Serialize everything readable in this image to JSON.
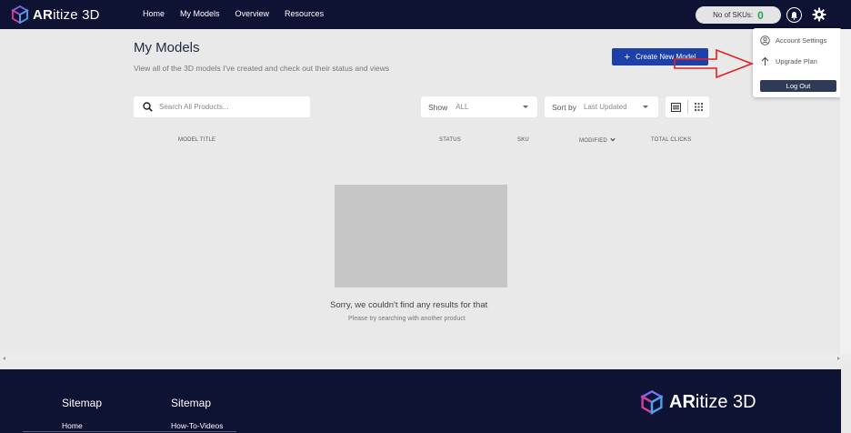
{
  "brand": {
    "name_bold": "AR",
    "name_rest": "itize 3D",
    "color": "#0e1233"
  },
  "nav": {
    "items": [
      "Home",
      "My Models",
      "Overview",
      "Resources"
    ]
  },
  "sku": {
    "label": "No of SKUs:",
    "count": "0"
  },
  "account_menu": {
    "items": [
      {
        "label": "Account Settings",
        "icon": "user-circle-icon"
      },
      {
        "label": "Upgrade Plan",
        "icon": "arrow-up-icon"
      }
    ],
    "logout_label": "Log Out"
  },
  "page": {
    "title": "My Models",
    "subtitle": "View all of the 3D models I've created and check out their status and views",
    "create_label": "Create New Model"
  },
  "search": {
    "placeholder": "Search All Products..."
  },
  "show": {
    "label": "Show",
    "value": "ALL"
  },
  "sort": {
    "label": "Sort by",
    "value": "Last Updated"
  },
  "table": {
    "columns": [
      "MODEL TITLE",
      "STATUS",
      "SKU",
      "MODIFIED",
      "TOTAL CLICKS"
    ]
  },
  "empty_state": {
    "title": "Sorry, we couldn't find any results for that",
    "subtitle": "Please try searching with another product"
  },
  "footer": {
    "headings": [
      "Sitemap",
      "Sitemap"
    ],
    "links": [
      "Home",
      "How-To-Videos"
    ],
    "logo_bold": "AR",
    "logo_rest": "itize 3D"
  },
  "colors": {
    "accent": "#1d3fa8",
    "sku_count": "#1fa94b",
    "annotation": "#e02020",
    "logout": "#2e3a56"
  }
}
